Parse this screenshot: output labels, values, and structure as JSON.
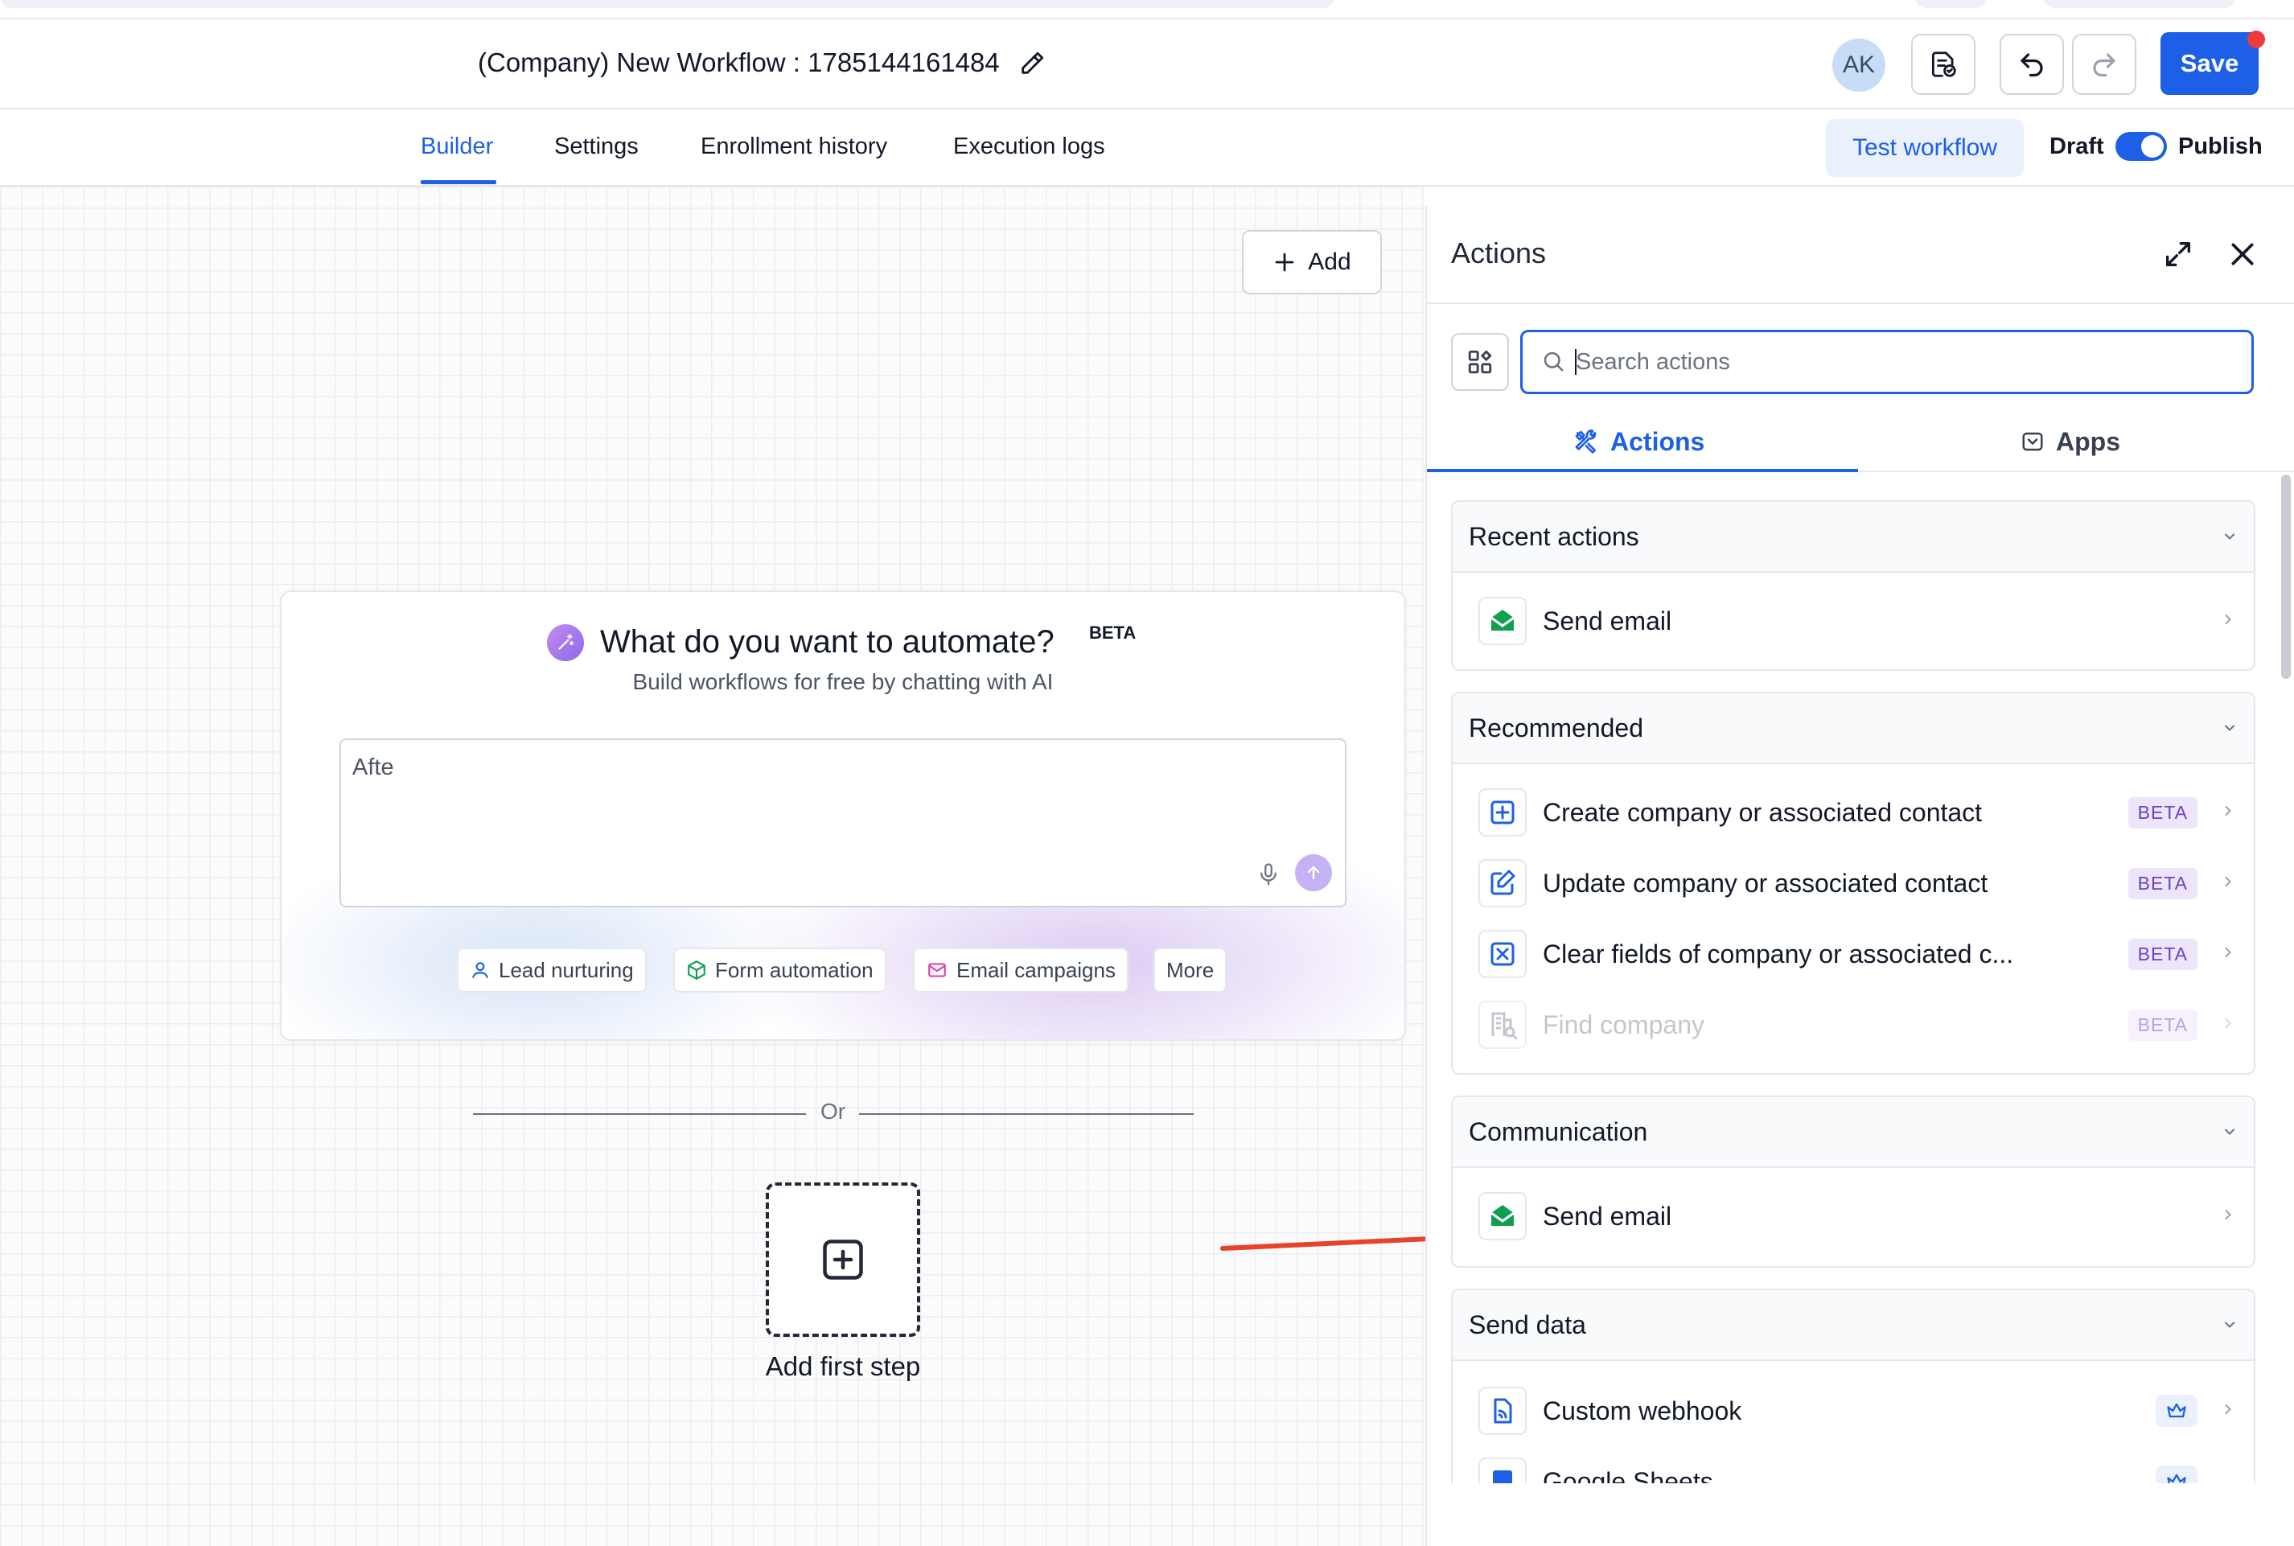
{
  "header": {
    "workflow_title": "(Company) New Workflow : 1785144161484",
    "avatar_initials": "AK",
    "save_label": "Save"
  },
  "subnav": {
    "tabs": [
      {
        "label": "Builder",
        "active": true
      },
      {
        "label": "Settings",
        "active": false
      },
      {
        "label": "Enrollment history",
        "active": false
      },
      {
        "label": "Execution logs",
        "active": false
      }
    ],
    "test_workflow_label": "Test workflow",
    "draft_label": "Draft",
    "publish_label": "Publish",
    "publish_on": true
  },
  "canvas": {
    "add_label": "Add",
    "ai": {
      "title": "What do you want to automate?",
      "beta": "BETA",
      "subtitle": "Build workflows for free by chatting with AI",
      "input_value": "Afte",
      "chips": [
        {
          "label": "Lead nurturing",
          "icon": "user-icon"
        },
        {
          "label": "Form automation",
          "icon": "cube-icon"
        },
        {
          "label": "Email campaigns",
          "icon": "mail-icon"
        },
        {
          "label": "More",
          "icon": ""
        }
      ]
    },
    "or_label": "Or",
    "first_step_label": "Add first step"
  },
  "panel": {
    "title": "Actions",
    "search_placeholder": "Search actions",
    "tabs": [
      {
        "label": "Actions",
        "active": true
      },
      {
        "label": "Apps",
        "active": false
      }
    ],
    "sections": [
      {
        "title": "Recent actions",
        "items": [
          {
            "label": "Send email",
            "icon": "send-email-icon"
          }
        ]
      },
      {
        "title": "Recommended",
        "items": [
          {
            "label": "Create company or associated contact",
            "badge": "BETA",
            "icon": "plus-square-icon"
          },
          {
            "label": "Update company or associated contact",
            "badge": "BETA",
            "icon": "edit-icon"
          },
          {
            "label": "Clear fields of company or associated c...",
            "badge": "BETA",
            "icon": "clear-square-icon"
          },
          {
            "label": "Find company",
            "badge": "BETA",
            "icon": "building-search-icon",
            "disabled": true
          }
        ]
      },
      {
        "title": "Communication",
        "items": [
          {
            "label": "Send email",
            "icon": "send-email-icon"
          }
        ]
      },
      {
        "title": "Send data",
        "items": [
          {
            "label": "Custom webhook",
            "icon": "webhook-icon",
            "premium": true
          },
          {
            "label": "Google Sheets",
            "icon": "sheets-icon",
            "premium": true
          }
        ]
      }
    ]
  },
  "colors": {
    "accent": "#1d5fe6",
    "beta_bg": "#ede6fb",
    "beta_text": "#6d3fc8",
    "email_green": "#0f9f4f",
    "annotation_arrow": "#e8432a"
  }
}
